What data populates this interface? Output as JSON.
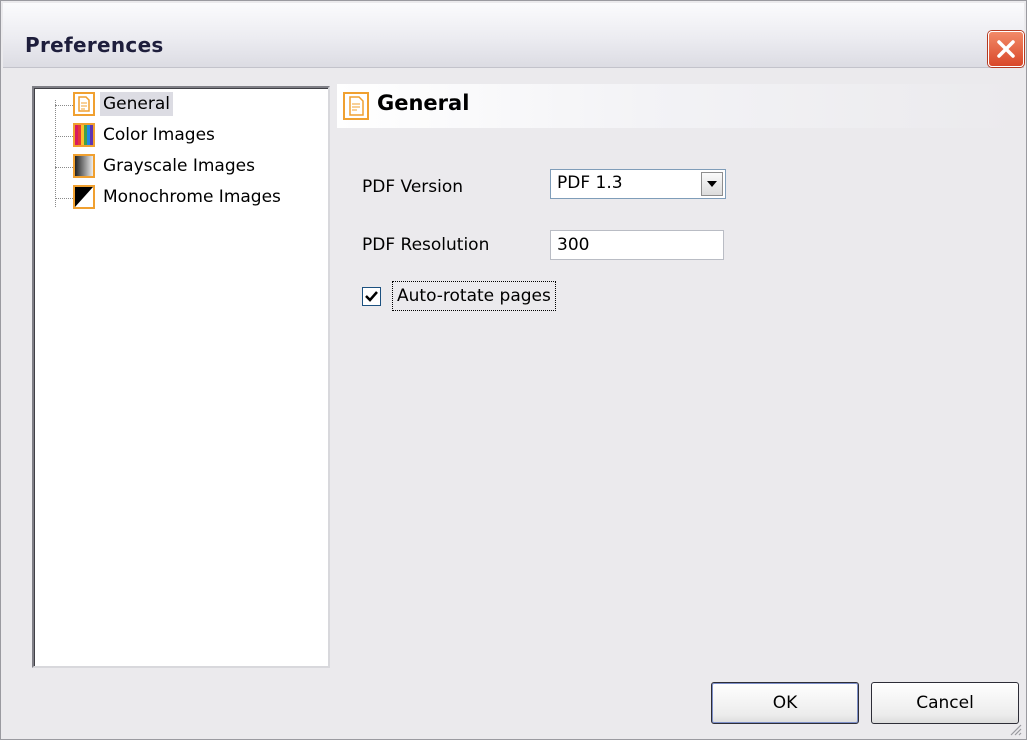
{
  "window": {
    "title": "Preferences"
  },
  "tree": {
    "items": [
      {
        "label": "General",
        "icon": "document-icon",
        "selected": true
      },
      {
        "label": "Color Images",
        "icon": "color-bars-icon",
        "selected": false
      },
      {
        "label": "Grayscale Images",
        "icon": "grayscale-gradient-icon",
        "selected": false
      },
      {
        "label": "Monochrome Images",
        "icon": "monochrome-triangle-icon",
        "selected": false
      }
    ]
  },
  "panel": {
    "title": "General",
    "pdf_version": {
      "label": "PDF Version",
      "value": "PDF 1.3"
    },
    "pdf_resolution": {
      "label": "PDF Resolution",
      "value": "300"
    },
    "auto_rotate": {
      "label": "Auto-rotate pages",
      "checked": true
    }
  },
  "buttons": {
    "ok": "OK",
    "cancel": "Cancel"
  },
  "colors": {
    "accent_orange": "#f0a030",
    "close_red": "#d9482a",
    "window_bg": "#ebeaed"
  }
}
